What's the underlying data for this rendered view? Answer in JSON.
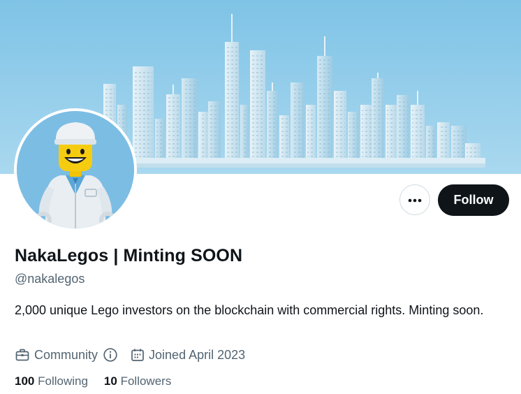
{
  "profile": {
    "display_name": "NakaLegos | Minting SOON",
    "handle": "@nakalegos",
    "bio": "2,000 unique Lego investors on the blockchain with commercial rights. Minting soon.",
    "category": "Community",
    "joined": "Joined April 2023"
  },
  "actions": {
    "follow_label": "Follow",
    "more_icon": "more-dots-icon"
  },
  "stats": {
    "following_count": "100",
    "following_label": "Following",
    "followers_count": "10",
    "followers_label": "Followers"
  },
  "icons": {
    "category": "briefcase-icon",
    "info": "info-icon",
    "joined": "calendar-icon"
  },
  "colors": {
    "banner_sky": "#8fcbe9",
    "text_primary": "#0f1419",
    "text_secondary": "#536471",
    "button_dark": "#0f1419",
    "border": "#cfd9de"
  }
}
